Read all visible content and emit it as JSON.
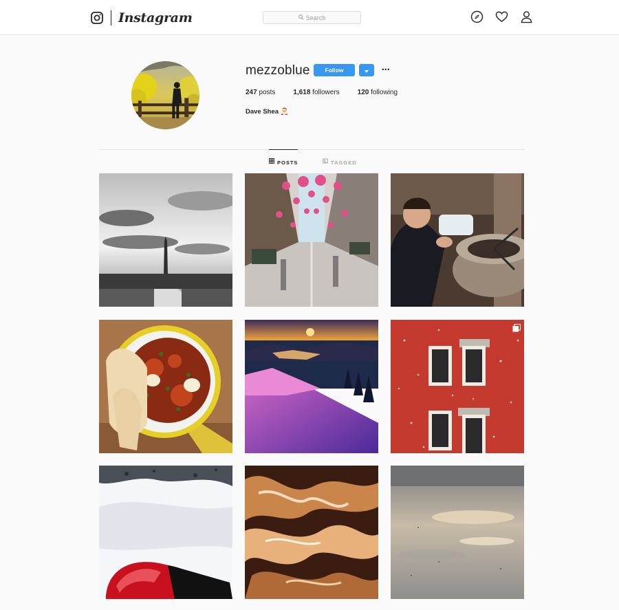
{
  "nav": {
    "brand_icon": "instagram-camera-icon",
    "brand_name": "Instagram",
    "search_placeholder": "Search",
    "icons": [
      "compass-icon",
      "heart-icon",
      "user-icon"
    ]
  },
  "profile": {
    "username": "mezzoblue",
    "follow_label": "Follow",
    "posts_count": "247",
    "posts_label": "posts",
    "followers_count": "1,618",
    "followers_label": "followers",
    "following_count": "120",
    "following_label": "following",
    "full_name": "Dave Shea 🎅"
  },
  "tabs": [
    {
      "label": "POSTS",
      "icon": "grid-icon",
      "active": true
    },
    {
      "label": "TAGGED",
      "icon": "tag-icon",
      "active": false
    }
  ],
  "posts": [
    {
      "subject": "washington-monument-bw"
    },
    {
      "subject": "street-pink-lanterns"
    },
    {
      "subject": "man-brewing-kettle"
    },
    {
      "subject": "shakshuka-pan"
    },
    {
      "subject": "mountain-sunset-snow"
    },
    {
      "subject": "red-brick-windows-snow",
      "multi": true
    },
    {
      "subject": "snowboard-slope"
    },
    {
      "subject": "marbled-abstract"
    },
    {
      "subject": "misty-water"
    }
  ],
  "colors": {
    "accent": "#3897f0",
    "text": "#262626",
    "muted": "#a8a8a8",
    "background": "#fafafa"
  }
}
